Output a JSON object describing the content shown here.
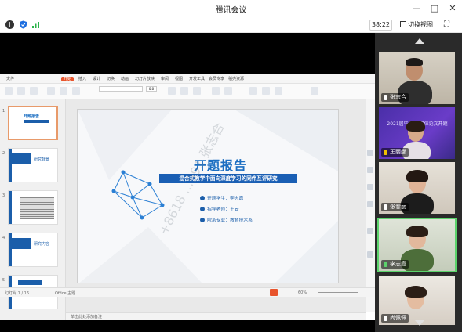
{
  "titlebar": {
    "title": "腾讯会议",
    "minimize": "—",
    "maximize": "□",
    "close": "✕"
  },
  "toolbar": {
    "info_icon": "info-icon",
    "shield_icon": "shield-icon",
    "signal_icon": "signal-icon",
    "timer": "38:22",
    "switch_view": "切换视图",
    "fullscreen_icon": "fullscreen-icon"
  },
  "shared_app": {
    "menu": [
      {
        "label": "文件"
      },
      {
        "label": "开始",
        "active": true
      },
      {
        "label": "插入"
      },
      {
        "label": "设计"
      },
      {
        "label": "切换"
      },
      {
        "label": "动画"
      },
      {
        "label": "幻灯片放映"
      },
      {
        "label": "审阅"
      },
      {
        "label": "视图"
      },
      {
        "label": "开发工具"
      },
      {
        "label": "会员专享"
      },
      {
        "label": "稻壳资源"
      }
    ],
    "font_size": "0.0",
    "notes_placeholder": "单击此处添加备注",
    "status": {
      "slide_counter": "幻灯片 1 / 16",
      "theme": "Office 主题",
      "zoom": "60%"
    },
    "thumbnails": [
      {
        "num": "1",
        "label": "开题报告"
      },
      {
        "num": "2",
        "label": "研究背景"
      },
      {
        "num": "3",
        "label": ""
      },
      {
        "num": "4",
        "label": "研究内容"
      },
      {
        "num": "5",
        "label": ""
      }
    ]
  },
  "slide": {
    "title": "开题报告",
    "subtitle": "混合式教学中面向深度学习的同伴互评研究",
    "student": "开题学生：李志霞",
    "advisor": "指导老师：王云",
    "major": "院系专业：教育技术系",
    "watermark": "+8618 …991 张志合"
  },
  "participants": [
    {
      "name": "张志合",
      "mic": true,
      "active": false
    },
    {
      "name": "王丽娜",
      "mic": false,
      "active": false,
      "banner_text": "2021届毕业生 学位论文开题"
    },
    {
      "name": "张春丽",
      "mic": true,
      "active": false
    },
    {
      "name": "李志霞",
      "mic": true,
      "active": true
    },
    {
      "name": "尚佩佩",
      "mic": true,
      "active": false
    }
  ],
  "colors": {
    "brand_blue": "#1b6ec2",
    "speaking_green": "#5bd36b",
    "wps_orange": "#e8542c"
  }
}
